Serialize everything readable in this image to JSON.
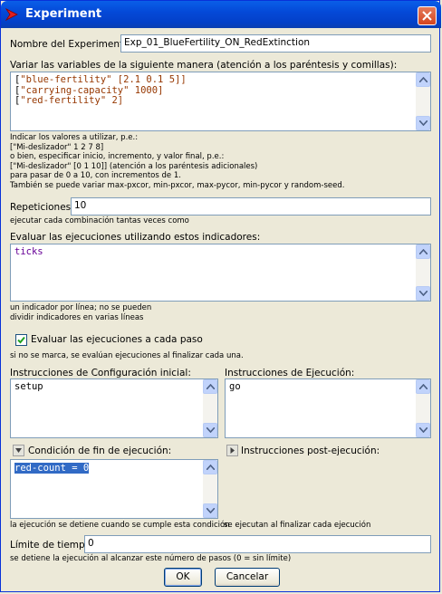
{
  "window": {
    "title": "Experiment"
  },
  "name_label": "Nombre del Experimento",
  "name_value": "Exp_01_BlueFertility_ON_RedExtinction",
  "vary_label": "Variar las variables de la siguiente manera (atención a los paréntesis y comillas):",
  "vary_lines": [
    [
      "[",
      "\"blue-fertility\"",
      " [2.1 0.1 5]]"
    ],
    [
      "[",
      "\"carrying-capacity\"",
      " 1000]"
    ],
    [
      "[",
      "\"red-fertility\"",
      " 2]"
    ]
  ],
  "vary_help": [
    "Indicar los valores a utilizar, p.e.:",
    "[\"Mi-deslizador\" 1 2 7 8]",
    "o bien, especificar inicio, incremento, y valor final, p.e.:",
    "[\"Mi-deslizador\" [0 1 10]] (atención a los paréntesis adicionales)",
    "para pasar de 0 a 10, con incrementos de 1.",
    "También se puede variar max-pxcor, min-pxcor, max-pycor, min-pycor y random-seed."
  ],
  "reps_label": "Repeticiones",
  "reps_value": "10",
  "reps_help": "ejecutar cada combinación tantas veces como",
  "metrics_label": "Evaluar las ejecuciones utilizando estos indicadores:",
  "metrics_value": "ticks",
  "metrics_help": [
    "un indicador por línea; no se pueden",
    "dividir indicadores en varias líneas"
  ],
  "every_step_label": "Evaluar las ejecuciones a cada paso",
  "every_step_checked": true,
  "every_step_help": "si no se marca, se evalúan ejecuciones al finalizar cada una.",
  "setup_label": "Instrucciones de Configuración inicial:",
  "setup_value": "setup",
  "go_label": "Instrucciones de Ejecución:",
  "go_value": "go",
  "stop_label": "Condición de fin de ejecución:",
  "stop_value": "red-count = 0",
  "stop_help": "la ejecución se detiene cuando se cumple esta condición",
  "post_label": "Instrucciones post-ejecución:",
  "post_help": "se ejecutan al finalizar cada ejecución",
  "time_label": "Límite de tiempo",
  "time_value": "0",
  "time_help": "se detiene la ejecución al alcanzar este número de pasos (0 = sin límite)",
  "ok_label": "OK",
  "cancel_label": "Cancelar",
  "colors": {
    "title_bar": "#0449d8",
    "dialog_bg": "#ece9d8",
    "string_color": "#963700",
    "reporter_color": "#660096",
    "selection": "#316ac5"
  },
  "icons": [
    "netlogo-logo-icon",
    "close-icon",
    "scroll-up-icon",
    "scroll-down-icon",
    "checkmark-icon",
    "triangle-down-icon",
    "triangle-right-icon"
  ]
}
